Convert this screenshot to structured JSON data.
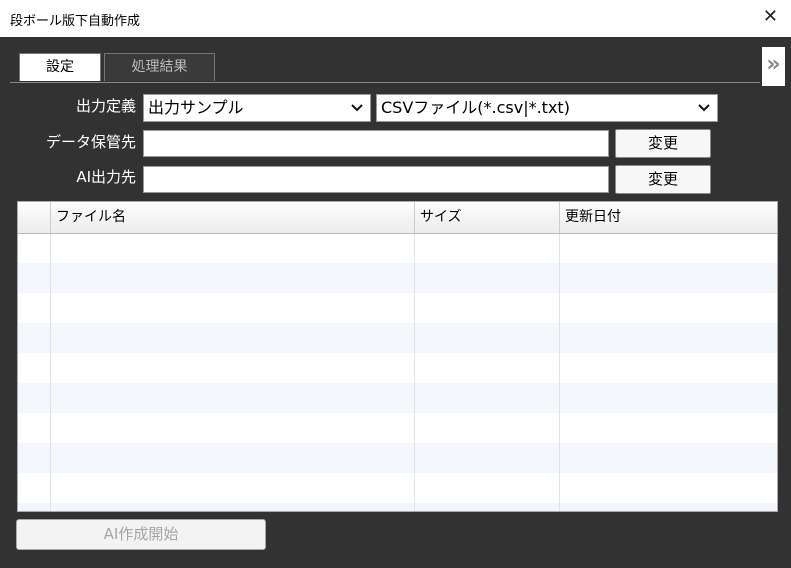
{
  "window": {
    "title": "段ボール版下自動作成",
    "close_symbol": "✕"
  },
  "tabs": [
    {
      "label": "設定",
      "active": true
    },
    {
      "label": "処理結果",
      "active": false
    }
  ],
  "expander_symbol": "»",
  "form": {
    "output_def_label": "出力定義",
    "output_def_value": "出力サンプル",
    "file_type_value": "CSVファイル(*.csv|*.txt)",
    "data_store_label": "データ保管先",
    "data_store_value": "",
    "ai_output_label": "AI出力先",
    "ai_output_value": "",
    "change_button": "変更"
  },
  "table": {
    "columns": [
      "ファイル名",
      "サイズ",
      "更新日付"
    ],
    "rows": []
  },
  "start_button": "AI作成開始",
  "colors": {
    "background": "#323232",
    "row_alt": "#f3f6fa",
    "disabled_text": "#a5a5a5"
  }
}
